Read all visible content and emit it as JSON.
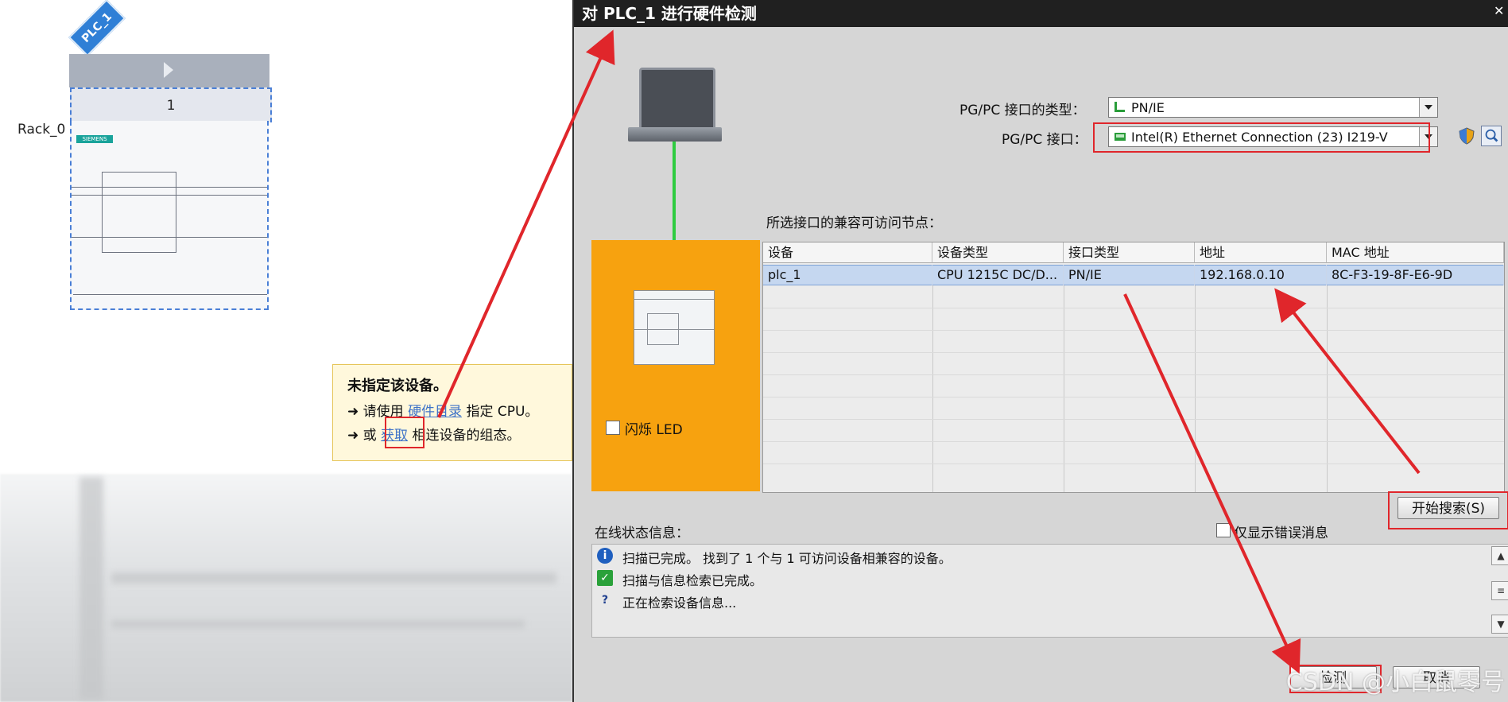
{
  "device_view": {
    "plc_tag": "PLC_1",
    "rack_label": "Rack_0",
    "slot_number": "1",
    "brand_chip": "SIEMENS",
    "hint": {
      "title": "未指定该设备。",
      "line1_prefix": "请使用",
      "line1_link": "硬件目录",
      "line1_suffix": "指定 CPU。",
      "line2_prefix": "或",
      "line2_link": "获取",
      "line2_suffix": "相连设备的组态。"
    }
  },
  "dialog": {
    "title": "对 PLC_1 进行硬件检测",
    "interface_type_label": "PG/PC 接口的类型：",
    "interface_type_value": "PN/IE",
    "interface_label": "PG/PC 接口：",
    "interface_value": "Intel(R) Ethernet Connection (23) I219-V",
    "flash_led_label": "闪烁 LED",
    "nodes_label": "所选接口的兼容可访问节点：",
    "table": {
      "columns": [
        "设备",
        "设备类型",
        "接口类型",
        "地址",
        "MAC 地址"
      ],
      "rows": [
        [
          "plc_1",
          "CPU 1215C DC/D...",
          "PN/IE",
          "192.168.0.10",
          "8C-F3-19-8F-E6-9D"
        ]
      ]
    },
    "start_search_button": "开始搜索(S)",
    "online_status_label": "在线状态信息：",
    "only_errors_label": "仅显示错误消息",
    "status_messages": [
      {
        "icon": "info-icon",
        "text": "扫描已完成。 找到了 1 个与 1 可访问设备相兼容的设备。"
      },
      {
        "icon": "check-icon",
        "text": "扫描与信息检索已完成。"
      },
      {
        "icon": "query-icon",
        "text": "正在检索设备信息..."
      }
    ],
    "detect_button": "检测",
    "cancel_button": "取消"
  },
  "watermark": "CSDN @小白鼠零号",
  "colors": {
    "annotation_red": "#e0262b",
    "orange_panel": "#f7a20f",
    "connection_green": "#2ecc40",
    "selection_blue": "#c5d7f0"
  }
}
